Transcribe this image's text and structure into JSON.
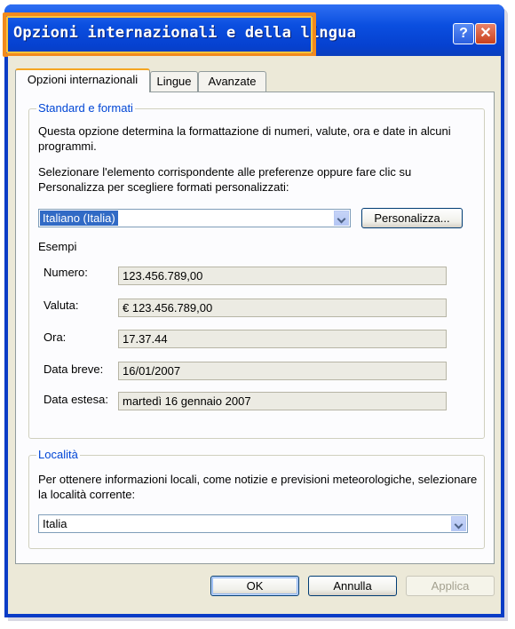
{
  "window": {
    "title": "Opzioni internazionali e della lingua"
  },
  "titlebar_buttons": {
    "help": "?",
    "close": "✕"
  },
  "tabs": [
    "Opzioni internazionali",
    "Lingue",
    "Avanzate"
  ],
  "standard": {
    "legend": "Standard e formati",
    "desc": "Questa opzione determina la formattazione di numeri, valute, ora e date in alcuni programmi.",
    "select_prompt": "Selezionare l'elemento corrispondente alle preferenze oppure fare clic su Personalizza per scegliere formati personalizzati:",
    "locale_value": "Italiano (Italia)",
    "customize_label": "Personalizza...",
    "examples_label": "Esempi",
    "examples": [
      {
        "label": "Numero:",
        "value": "123.456.789,00"
      },
      {
        "label": "Valuta:",
        "value": "€ 123.456.789,00"
      },
      {
        "label": "Ora:",
        "value": "17.37.44"
      },
      {
        "label": "Data breve:",
        "value": "16/01/2007"
      },
      {
        "label": "Data estesa:",
        "value": "martedì 16 gennaio 2007"
      }
    ]
  },
  "location": {
    "legend": "Località",
    "desc": "Per ottenere informazioni locali, come notizie e previsioni meteorologiche, selezionare la località corrente:",
    "value": "Italia"
  },
  "buttons": {
    "ok": "OK",
    "cancel": "Annulla",
    "apply": "Applica"
  }
}
